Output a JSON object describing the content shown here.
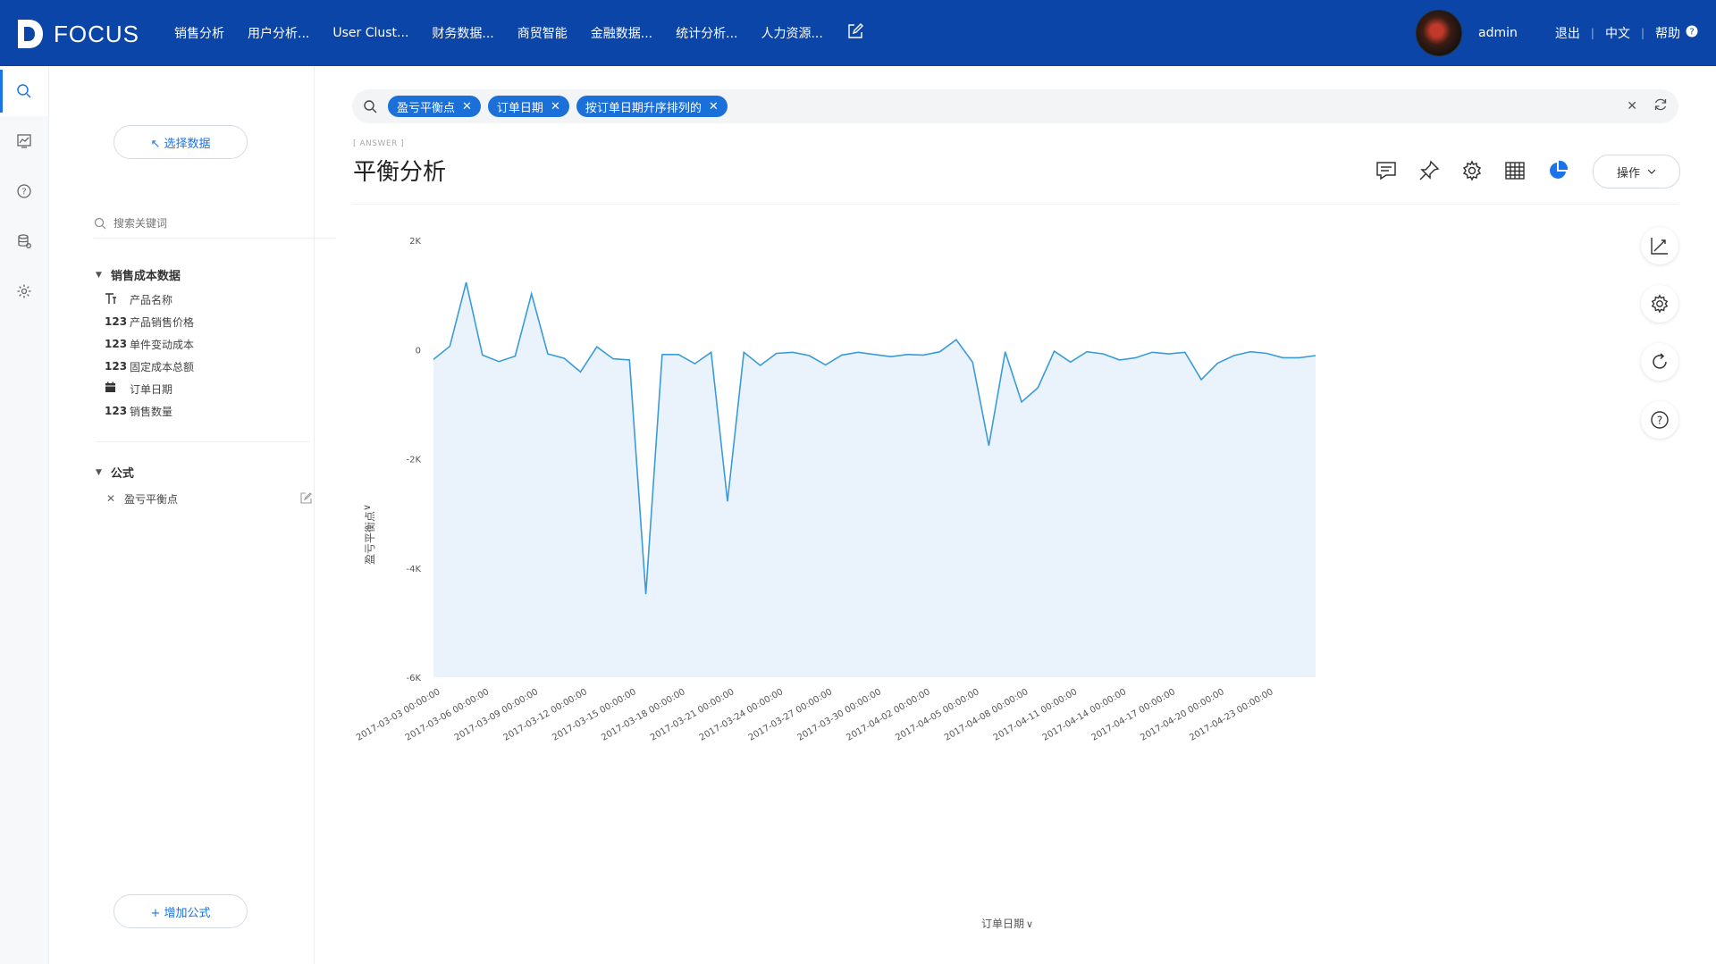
{
  "app": {
    "logo_text": "FOCUS",
    "nav": [
      "销售分析",
      "用户分析...",
      "User Clust...",
      "财务数据...",
      "商贸智能",
      "金融数据...",
      "统计分析...",
      "人力资源..."
    ],
    "user": "admin",
    "logout": "退出",
    "language": "中文",
    "help": "帮助",
    "brand_color": "#0b45a8",
    "accent_color": "#1a73e8"
  },
  "iconbar": [
    "search-icon",
    "chart-icon",
    "question-icon",
    "database-icon",
    "gear-icon"
  ],
  "sidebar": {
    "select_data": "↖ 选择数据",
    "search_placeholder": "搜索关键词",
    "group1": {
      "title": "销售成本数据",
      "fields": [
        {
          "type": "T",
          "name": "产品名称"
        },
        {
          "type": "123",
          "name": "产品销售价格"
        },
        {
          "type": "123",
          "name": "单件变动成本"
        },
        {
          "type": "123",
          "name": "固定成本总额"
        },
        {
          "type": "cal",
          "name": "订单日期"
        },
        {
          "type": "123",
          "name": "销售数量"
        }
      ]
    },
    "group2": {
      "title": "公式",
      "items": [
        {
          "name": "盈亏平衡点"
        }
      ]
    },
    "add_formula": "+ 增加公式"
  },
  "search": {
    "chips": [
      "盈亏平衡点",
      "订单日期",
      "按订单日期升序排列的"
    ]
  },
  "answer": {
    "tag": "[ ANSWER ]",
    "title": "平衡分析",
    "operate": "操作"
  },
  "chart_data": {
    "type": "area",
    "ylabel": "盈亏平衡点",
    "xlabel": "订单日期",
    "ylim": [
      -6000,
      2000
    ],
    "y_ticks": [
      2000,
      0,
      -2000,
      -4000,
      -6000
    ],
    "y_tick_labels": [
      "2K",
      "0",
      "-2K",
      "-4K",
      "-6K"
    ],
    "x_tick_labels": [
      "2017-03-03 00:00:00",
      "2017-03-06 00:00:00",
      "2017-03-09 00:00:00",
      "2017-03-12 00:00:00",
      "2017-03-15 00:00:00",
      "2017-03-18 00:00:00",
      "2017-03-21 00:00:00",
      "2017-03-24 00:00:00",
      "2017-03-27 00:00:00",
      "2017-03-30 00:00:00",
      "2017-04-02 00:00:00",
      "2017-04-05 00:00:00",
      "2017-04-08 00:00:00",
      "2017-04-11 00:00:00",
      "2017-04-14 00:00:00",
      "2017-04-17 00:00:00",
      "2017-04-20 00:00:00",
      "2017-04-23 00:00:00"
    ],
    "x_start": "2017-03-03",
    "x_end": "2017-04-26",
    "series": [
      {
        "values": [
          -180,
          60,
          1230,
          -100,
          -220,
          -120,
          1020,
          -80,
          -160,
          -410,
          50,
          -170,
          -190,
          -4480,
          -90,
          -90,
          -260,
          -50,
          -2780,
          -50,
          -290,
          -70,
          -50,
          -110,
          -280,
          -100,
          -50,
          -90,
          -130,
          -90,
          -100,
          -40,
          180,
          -230,
          -1760,
          -40,
          -960,
          -700,
          -30,
          -230,
          -40,
          -80,
          -190,
          -150,
          -50,
          -80,
          -50,
          -550,
          -250,
          -110,
          -40,
          -70,
          -150,
          -150,
          -110
        ],
        "color": "#3a9bd9"
      }
    ],
    "grid": false,
    "legend": "none"
  }
}
